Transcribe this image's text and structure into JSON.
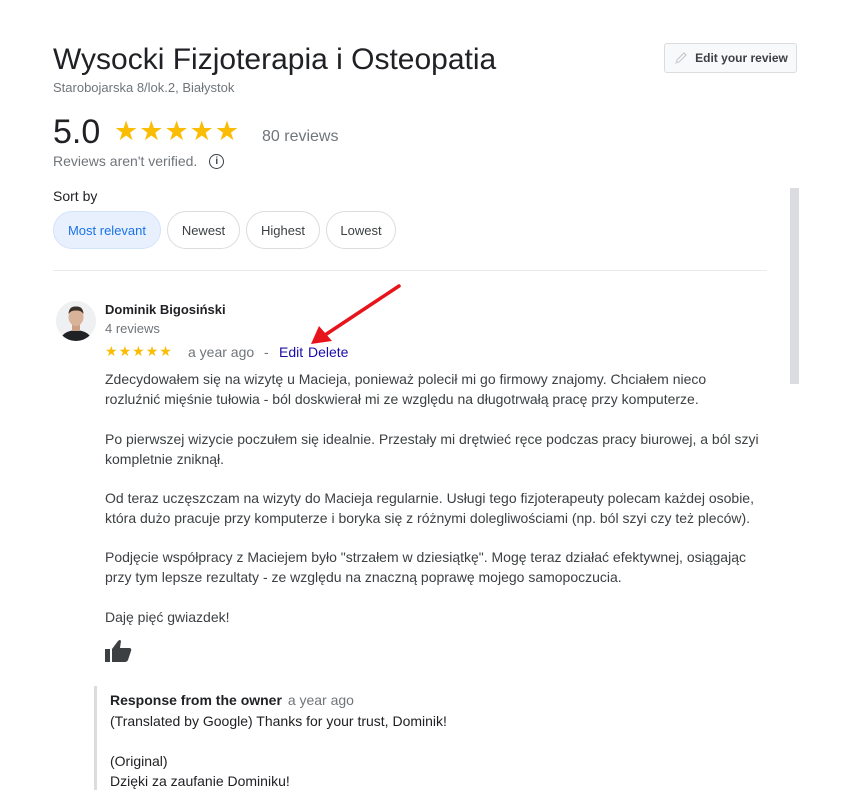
{
  "business": {
    "name": "Wysocki Fizjoterapia i Osteopatia",
    "address": "Starobojarska 8/lok.2, Białystok",
    "edit_review_label": "Edit your review",
    "rating": "5.0",
    "stars": [
      "★",
      "★",
      "★",
      "★",
      "★"
    ],
    "reviews_count": "80 reviews",
    "not_verified": "Reviews aren't verified."
  },
  "sort": {
    "label": "Sort by",
    "options": [
      "Most relevant",
      "Newest",
      "Highest",
      "Lowest"
    ],
    "selected": "Most relevant"
  },
  "review": {
    "author": "Dominik Bigosiński",
    "author_reviews": "4 reviews",
    "stars": [
      "★",
      "★",
      "★",
      "★",
      "★"
    ],
    "date": "a year ago",
    "separator": "-",
    "edit_label": "Edit",
    "delete_label": "Delete",
    "paragraphs": [
      "Zdecydowałem się na wizytę u Macieja, ponieważ polecił mi go firmowy znajomy. Chciałem nieco rozluźnić mięśnie tułowia - ból doskwierał mi ze względu na długotrwałą pracę przy komputerze.",
      "Po pierwszej wizycie poczułem się idealnie. Przestały mi drętwieć ręce podczas pracy biurowej, a ból szyi kompletnie zniknął.",
      "Od teraz uczęszczam na wizyty do Macieja regularnie. Usługi tego fizjoterapeuty polecam każdej osobie, która dużo pracuje przy komputerze i boryka się z różnymi dolegliwościami (np. ból szyi czy też pleców).",
      "Podjęcie współpracy z Maciejem było \"strzałem w dziesiątkę\". Mogę teraz działać efektywnej, osiągając przy tym lepsze rezultaty - ze względu na znaczną poprawę mojego samopoczucia.",
      "Daję pięć gwiazdek!"
    ]
  },
  "owner_response": {
    "heading": "Response from the owner",
    "date": "a year ago",
    "translated": "(Translated by Google) Thanks for your trust, Dominik!",
    "original_label": "(Original)",
    "original_text": "Dzięki za zaufanie Dominiku!"
  },
  "colors": {
    "star": "#fbbc04",
    "link": "#1a0dab",
    "active_chip_bg": "#e8f0fe",
    "active_chip_text": "#1a73e8",
    "annotation_arrow": "#e8141c"
  },
  "icons": {
    "edit_review": "pencil-icon",
    "info": "info-icon",
    "like": "thumbs-up-icon",
    "annotation": "red-arrow-annotation"
  }
}
